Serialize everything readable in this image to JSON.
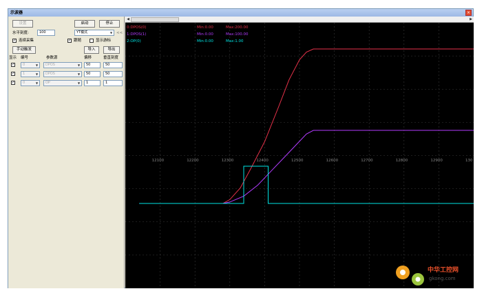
{
  "window": {
    "title": "示波器"
  },
  "controls": {
    "settings_btn": "设置",
    "start_btn": "启动",
    "stop_btn": "停止",
    "sample_label": "水平刻度:",
    "sample_value": "100",
    "mode_value": "YT模式",
    "collapse_btn": "<<",
    "continuous_label": "连续采集",
    "follow_label": "跟随",
    "cursor_label": "显示游标",
    "manual_trigger_btn": "手动触发",
    "import_btn": "导入",
    "export_btn": "导出"
  },
  "table": {
    "headers": [
      "显示",
      "编号",
      "参数源",
      "偏移",
      "垂直刻度"
    ],
    "rows": [
      {
        "checked": true,
        "number": "0",
        "source": "DPOS",
        "offset": "50",
        "scale": "50"
      },
      {
        "checked": true,
        "number": "1",
        "source": "DPOS",
        "offset": "50",
        "scale": "50"
      },
      {
        "checked": true,
        "number": "0",
        "source": "OP",
        "offset": "1",
        "scale": "1"
      }
    ]
  },
  "legend": [
    {
      "name": "0:DPOS(0)",
      "min": "Min:0.00",
      "max": "Max:200.00",
      "color": "#e8324a"
    },
    {
      "name": "1:DPOS(1)",
      "min": "Min:0.00",
      "max": "Max:100.00",
      "color": "#b33cff"
    },
    {
      "name": "2:OP(0)",
      "min": "Min:0.00",
      "max": "Max:1.00",
      "color": "#00e5e5"
    }
  ],
  "scrollbar": {
    "left": "◀",
    "right": "▶"
  },
  "chart_data": {
    "type": "line",
    "x_tick_labels": [
      "12100",
      "12200",
      "12300",
      "12400",
      "12500",
      "12600",
      "12700",
      "12800",
      "12900",
      "130"
    ],
    "series": [
      {
        "name": "0:DPOS(0)",
        "color": "#e8324a",
        "x": [
          12040,
          12100,
          12200,
          12280,
          12300,
          12330,
          12360,
          12400,
          12440,
          12470,
          12500,
          12520,
          12540,
          12600,
          12700,
          12800,
          12900,
          13000
        ],
        "y": [
          0,
          0,
          0,
          0,
          5,
          20,
          45,
          80,
          125,
          160,
          186,
          196,
          200,
          200,
          200,
          200,
          200,
          200
        ]
      },
      {
        "name": "1:DPOS(1)",
        "color": "#b33cff",
        "x": [
          12040,
          12100,
          12200,
          12280,
          12300,
          12340,
          12380,
          12420,
          12460,
          12500,
          12520,
          12540,
          12600,
          12700,
          12800,
          12900,
          13000
        ],
        "y": [
          0,
          0,
          0,
          0,
          2,
          10,
          25,
          45,
          65,
          85,
          95,
          100,
          100,
          100,
          100,
          100,
          100
        ]
      },
      {
        "name": "2:OP(0)",
        "color": "#00e5e5",
        "x": [
          12040,
          12100,
          12200,
          12300,
          12340,
          12340,
          12410,
          12410,
          12500,
          12600,
          12700,
          12800,
          12900,
          13000
        ],
        "y": [
          0,
          0,
          0,
          0,
          0,
          1,
          1,
          0,
          0,
          0,
          0,
          0,
          0,
          0
        ]
      }
    ]
  },
  "watermark": {
    "cn": "中华工控网",
    "en": "gkong.com"
  }
}
